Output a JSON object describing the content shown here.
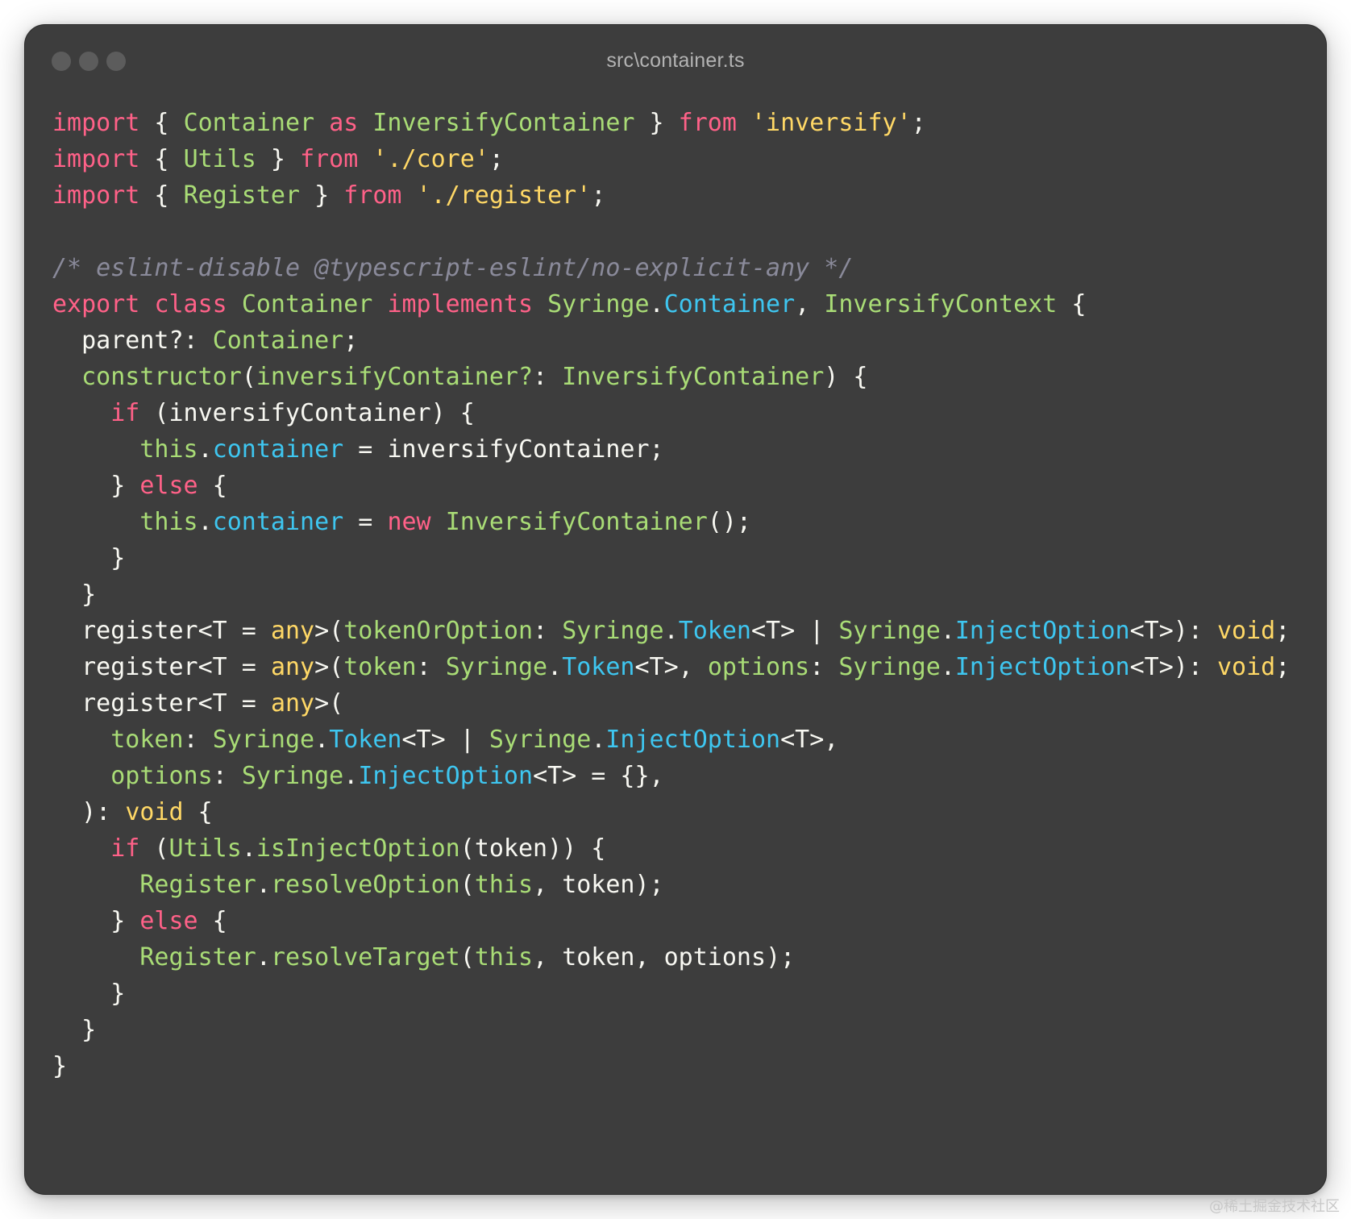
{
  "window": {
    "title": "src\\container.ts",
    "traffic_lights": [
      "close-dot",
      "minimize-dot",
      "zoom-dot"
    ]
  },
  "colors": {
    "background": "#3d3d3d",
    "keyword": "#ff6188",
    "type": "#a9dc76",
    "string": "#ffd866",
    "comment": "#8a8a9a",
    "property": "#3ec6f0",
    "plain": "#f8f8f2"
  },
  "code": {
    "lines": [
      [
        [
          "kw",
          "import"
        ],
        [
          "pun",
          " { "
        ],
        [
          "type",
          "Container"
        ],
        [
          "pun",
          " "
        ],
        [
          "kw",
          "as"
        ],
        [
          "pun",
          " "
        ],
        [
          "type",
          "InversifyContainer"
        ],
        [
          "pun",
          " } "
        ],
        [
          "kw",
          "from"
        ],
        [
          "pun",
          " "
        ],
        [
          "str",
          "'inversify'"
        ],
        [
          "pun",
          ";"
        ]
      ],
      [
        [
          "kw",
          "import"
        ],
        [
          "pun",
          " { "
        ],
        [
          "type",
          "Utils"
        ],
        [
          "pun",
          " } "
        ],
        [
          "kw",
          "from"
        ],
        [
          "pun",
          " "
        ],
        [
          "str",
          "'./core'"
        ],
        [
          "pun",
          ";"
        ]
      ],
      [
        [
          "kw",
          "import"
        ],
        [
          "pun",
          " { "
        ],
        [
          "type",
          "Register"
        ],
        [
          "pun",
          " } "
        ],
        [
          "kw",
          "from"
        ],
        [
          "pun",
          " "
        ],
        [
          "str",
          "'./register'"
        ],
        [
          "pun",
          ";"
        ]
      ],
      [],
      [
        [
          "cm",
          "/* eslint-disable @typescript-eslint/no-explicit-any */"
        ]
      ],
      [
        [
          "kw",
          "export"
        ],
        [
          "pun",
          " "
        ],
        [
          "kw",
          "class"
        ],
        [
          "pun",
          " "
        ],
        [
          "type",
          "Container"
        ],
        [
          "pun",
          " "
        ],
        [
          "kw",
          "implements"
        ],
        [
          "pun",
          " "
        ],
        [
          "type",
          "Syringe"
        ],
        [
          "pun",
          "."
        ],
        [
          "prop",
          "Container"
        ],
        [
          "pun",
          ", "
        ],
        [
          "type",
          "InversifyContext"
        ],
        [
          "pun",
          " {"
        ]
      ],
      [
        [
          "pun",
          "  "
        ],
        [
          "var",
          "parent?"
        ],
        [
          "pun",
          ": "
        ],
        [
          "type",
          "Container"
        ],
        [
          "pun",
          ";"
        ]
      ],
      [
        [
          "pun",
          "  "
        ],
        [
          "type",
          "constructor"
        ],
        [
          "pun",
          "("
        ],
        [
          "type",
          "inversifyContainer?"
        ],
        [
          "pun",
          ": "
        ],
        [
          "type",
          "InversifyContainer"
        ],
        [
          "pun",
          ") {"
        ]
      ],
      [
        [
          "pun",
          "    "
        ],
        [
          "kw",
          "if"
        ],
        [
          "pun",
          " ("
        ],
        [
          "var",
          "inversifyContainer"
        ],
        [
          "pun",
          ") {"
        ]
      ],
      [
        [
          "pun",
          "      "
        ],
        [
          "type",
          "this"
        ],
        [
          "pun",
          "."
        ],
        [
          "prop",
          "container"
        ],
        [
          "pun",
          " = "
        ],
        [
          "var",
          "inversifyContainer"
        ],
        [
          "pun",
          ";"
        ]
      ],
      [
        [
          "pun",
          "    } "
        ],
        [
          "kw",
          "else"
        ],
        [
          "pun",
          " {"
        ]
      ],
      [
        [
          "pun",
          "      "
        ],
        [
          "type",
          "this"
        ],
        [
          "pun",
          "."
        ],
        [
          "prop",
          "container"
        ],
        [
          "pun",
          " = "
        ],
        [
          "kw",
          "new"
        ],
        [
          "pun",
          " "
        ],
        [
          "type",
          "InversifyContainer"
        ],
        [
          "pun",
          "();"
        ]
      ],
      [
        [
          "pun",
          "    }"
        ]
      ],
      [
        [
          "pun",
          "  }"
        ]
      ],
      [
        [
          "pun",
          "  "
        ],
        [
          "var",
          "register<T"
        ],
        [
          "pun",
          " = "
        ],
        [
          "str",
          "any"
        ],
        [
          "pun",
          ">("
        ],
        [
          "type",
          "tokenOrOption"
        ],
        [
          "pun",
          ": "
        ],
        [
          "type",
          "Syringe"
        ],
        [
          "pun",
          "."
        ],
        [
          "prop",
          "Token"
        ],
        [
          "pun",
          "<T> | "
        ],
        [
          "type",
          "Syringe"
        ],
        [
          "pun",
          "."
        ],
        [
          "prop",
          "InjectOption"
        ],
        [
          "pun",
          "<T>): "
        ],
        [
          "str",
          "void"
        ],
        [
          "pun",
          ";"
        ]
      ],
      [
        [
          "pun",
          "  "
        ],
        [
          "var",
          "register<T"
        ],
        [
          "pun",
          " = "
        ],
        [
          "str",
          "any"
        ],
        [
          "pun",
          ">("
        ],
        [
          "type",
          "token"
        ],
        [
          "pun",
          ": "
        ],
        [
          "type",
          "Syringe"
        ],
        [
          "pun",
          "."
        ],
        [
          "prop",
          "Token"
        ],
        [
          "pun",
          "<T>, "
        ],
        [
          "type",
          "options"
        ],
        [
          "pun",
          ": "
        ],
        [
          "type",
          "Syringe"
        ],
        [
          "pun",
          "."
        ],
        [
          "prop",
          "InjectOption"
        ],
        [
          "pun",
          "<T>): "
        ],
        [
          "str",
          "void"
        ],
        [
          "pun",
          ";"
        ]
      ],
      [
        [
          "pun",
          "  "
        ],
        [
          "var",
          "register<T"
        ],
        [
          "pun",
          " = "
        ],
        [
          "str",
          "any"
        ],
        [
          "pun",
          ">("
        ]
      ],
      [
        [
          "pun",
          "    "
        ],
        [
          "type",
          "token"
        ],
        [
          "pun",
          ": "
        ],
        [
          "type",
          "Syringe"
        ],
        [
          "pun",
          "."
        ],
        [
          "prop",
          "Token"
        ],
        [
          "pun",
          "<T> | "
        ],
        [
          "type",
          "Syringe"
        ],
        [
          "pun",
          "."
        ],
        [
          "prop",
          "InjectOption"
        ],
        [
          "pun",
          "<T>,"
        ]
      ],
      [
        [
          "pun",
          "    "
        ],
        [
          "type",
          "options"
        ],
        [
          "pun",
          ": "
        ],
        [
          "type",
          "Syringe"
        ],
        [
          "pun",
          "."
        ],
        [
          "prop",
          "InjectOption"
        ],
        [
          "pun",
          "<T> = {},"
        ]
      ],
      [
        [
          "pun",
          "  ): "
        ],
        [
          "str",
          "void"
        ],
        [
          "pun",
          " {"
        ]
      ],
      [
        [
          "pun",
          "    "
        ],
        [
          "kw",
          "if"
        ],
        [
          "pun",
          " ("
        ],
        [
          "type",
          "Utils"
        ],
        [
          "pun",
          "."
        ],
        [
          "type",
          "isInjectOption"
        ],
        [
          "pun",
          "("
        ],
        [
          "var",
          "token"
        ],
        [
          "pun",
          ")) {"
        ]
      ],
      [
        [
          "pun",
          "      "
        ],
        [
          "type",
          "Register"
        ],
        [
          "pun",
          "."
        ],
        [
          "type",
          "resolveOption"
        ],
        [
          "pun",
          "("
        ],
        [
          "type",
          "this"
        ],
        [
          "pun",
          ", "
        ],
        [
          "var",
          "token"
        ],
        [
          "pun",
          ");"
        ]
      ],
      [
        [
          "pun",
          "    } "
        ],
        [
          "kw",
          "else"
        ],
        [
          "pun",
          " {"
        ]
      ],
      [
        [
          "pun",
          "      "
        ],
        [
          "type",
          "Register"
        ],
        [
          "pun",
          "."
        ],
        [
          "type",
          "resolveTarget"
        ],
        [
          "pun",
          "("
        ],
        [
          "type",
          "this"
        ],
        [
          "pun",
          ", "
        ],
        [
          "var",
          "token"
        ],
        [
          "pun",
          ", "
        ],
        [
          "var",
          "options"
        ],
        [
          "pun",
          ");"
        ]
      ],
      [
        [
          "pun",
          "    }"
        ]
      ],
      [
        [
          "pun",
          "  }"
        ]
      ],
      [
        [
          "pun",
          "}"
        ]
      ]
    ]
  },
  "watermark": "@稀土掘金技术社区"
}
